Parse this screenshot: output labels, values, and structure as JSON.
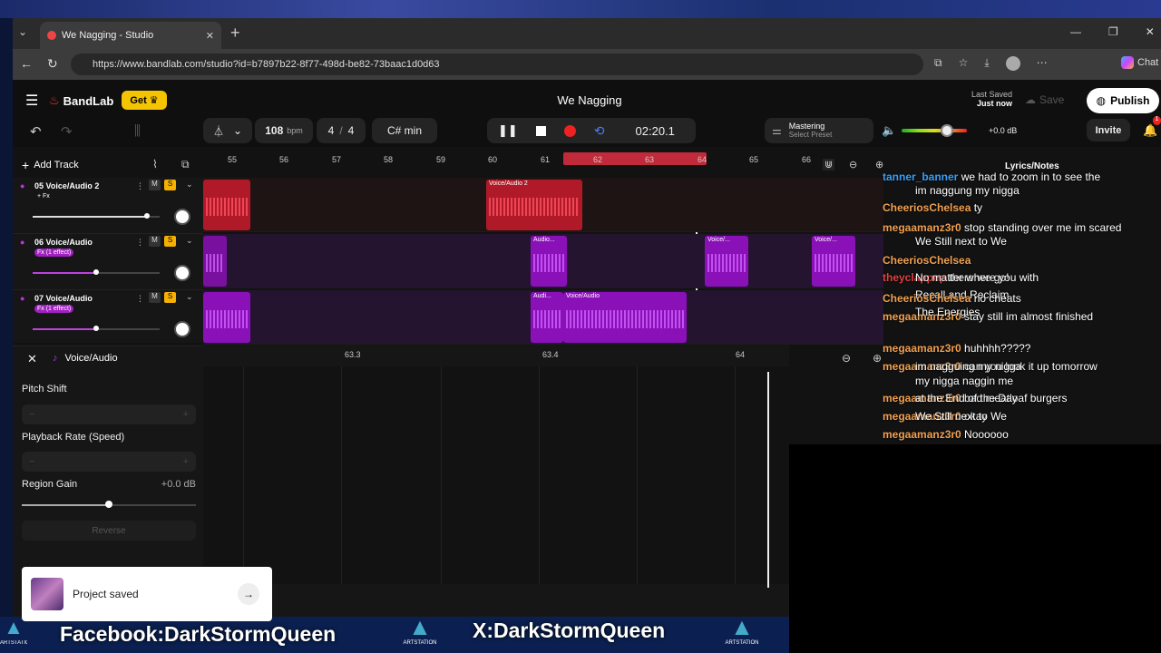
{
  "browser": {
    "tab_title": "We Nagging - Studio",
    "url": "https://www.bandlab.com/studio?id=b7897b22-8f77-498d-be82-73baac1d0d63",
    "chat_label": "Chat"
  },
  "app": {
    "brand": "BandLab",
    "get_label": "Get",
    "project_title": "We Nagging",
    "last_saved_label": "Last Saved",
    "last_saved_value": "Just now",
    "save_label": "Save",
    "publish_label": "Publish",
    "invite_label": "Invite",
    "notification_count": "1"
  },
  "transport": {
    "tempo": "108",
    "tempo_unit": "bpm",
    "time_sig_num": "4",
    "time_sig_den": "4",
    "key": "C# min",
    "time": "02:20.1",
    "mastering_label": "Mastering",
    "mastering_preset": "Select Preset",
    "master_gain": "+0.0 dB",
    "master_volume": 0.7
  },
  "timeline": {
    "add_track_label": "Add Track",
    "ruler_marks": [
      "55",
      "56",
      "57",
      "58",
      "59",
      "60",
      "61",
      "62",
      "63",
      "64",
      "65",
      "66"
    ],
    "lyrics_label": "Lyrics/Notes"
  },
  "tracks": [
    {
      "number": "05",
      "name": "Voice/Audio 2",
      "fx": "+ Fx",
      "mute": "M",
      "solo": "S",
      "volume": 0.9,
      "regions": [
        {
          "label": ""
        },
        {
          "label": "Voice/Audio 2"
        }
      ]
    },
    {
      "number": "06",
      "name": "Voice/Audio",
      "fx": "Fx (1 effect)",
      "mute": "M",
      "solo": "S",
      "volume": 0.5,
      "regions": [
        {
          "label": ""
        },
        {
          "label": "Audio..."
        },
        {
          "label": "Voice/..."
        },
        {
          "label": "Voice/..."
        }
      ]
    },
    {
      "number": "07",
      "name": "Voice/Audio",
      "fx": "Fx (1 effect)",
      "mute": "M",
      "solo": "S",
      "volume": 0.5,
      "regions": [
        {
          "label": ""
        },
        {
          "label": "Audi..."
        },
        {
          "label": "Voice/Audio"
        }
      ]
    }
  ],
  "editor": {
    "title": "Voice/Audio",
    "ruler_marks": [
      "63.3",
      "63.4",
      "64"
    ],
    "pitch_shift_label": "Pitch Shift",
    "playback_rate_label": "Playback Rate (Speed)",
    "region_gain_label": "Region Gain",
    "region_gain_value": "+0.0 dB",
    "region_gain_level": 0.5,
    "reverse_label": "Reverse",
    "stepper_minus": "−",
    "stepper_plus": "+"
  },
  "toast": {
    "message": "Project saved"
  },
  "chat": [
    {
      "user": "tanner_banner",
      "color": "#3a9ef5",
      "text": "we had to zoom in to see the"
    },
    {
      "user": "",
      "color": "#ffffff",
      "text": "im naggung my nigga"
    },
    {
      "user": "CheeriosChelsea",
      "color": "#f0a050",
      "text": "ty"
    },
    {
      "user": "megaamanz3r0",
      "color": "#f0a050",
      "text": "stop standing over me im scared"
    },
    {
      "user": "",
      "color": "#ffffff",
      "text": "We Still next to We"
    },
    {
      "user": "CheeriosChelsea",
      "color": "#f0a050",
      "text": ""
    },
    {
      "user": "theyclappep",
      "color": "#e04040",
      "text": "there we go!"
    },
    {
      "user": "",
      "color": "#ffffff",
      "text": "No matter where you with"
    },
    {
      "user": "",
      "color": "#ffffff",
      "text": "Recall and Reclaim"
    },
    {
      "user": "CheeriosChelsea",
      "color": "#f0a050",
      "text": "no cheats"
    },
    {
      "user": "megaamanz3r0",
      "color": "#f0a050",
      "text": "stay still im almost finished"
    },
    {
      "user": "",
      "color": "#ffffff",
      "text": "The Energies"
    },
    {
      "user": "megaamanz3r0",
      "color": "#f0a050",
      "text": "huhhhh?????"
    },
    {
      "user": "megaamanz3r0",
      "color": "#f0a050",
      "text": "can you look it up tomorrow"
    },
    {
      "user": "",
      "color": "#ffffff",
      "text": "im nagguing my nigga"
    },
    {
      "user": "",
      "color": "#ffffff",
      "text": "my nigga naggin me"
    },
    {
      "user": "megaamanz3r0",
      "color": "#f0a050",
      "text": "bad meatloaf burgers"
    },
    {
      "user": "",
      "color": "#ffffff",
      "text": "at the End of the Day"
    },
    {
      "user": "megaamanz3r0",
      "color": "#f0a050",
      "text": "okay"
    },
    {
      "user": "",
      "color": "#ffffff",
      "text": "We Still next to We"
    },
    {
      "user": "megaamanz3r0",
      "color": "#f0a050",
      "text": "Noooooo"
    }
  ],
  "overlay": {
    "facebook": "Facebook:DarkStormQueen",
    "x": "X:DarkStormQueen",
    "artstation_a": "ARTSTATION",
    "artstation_b": "ARTSTATION",
    "artstation_c": "ARTSTATION"
  }
}
